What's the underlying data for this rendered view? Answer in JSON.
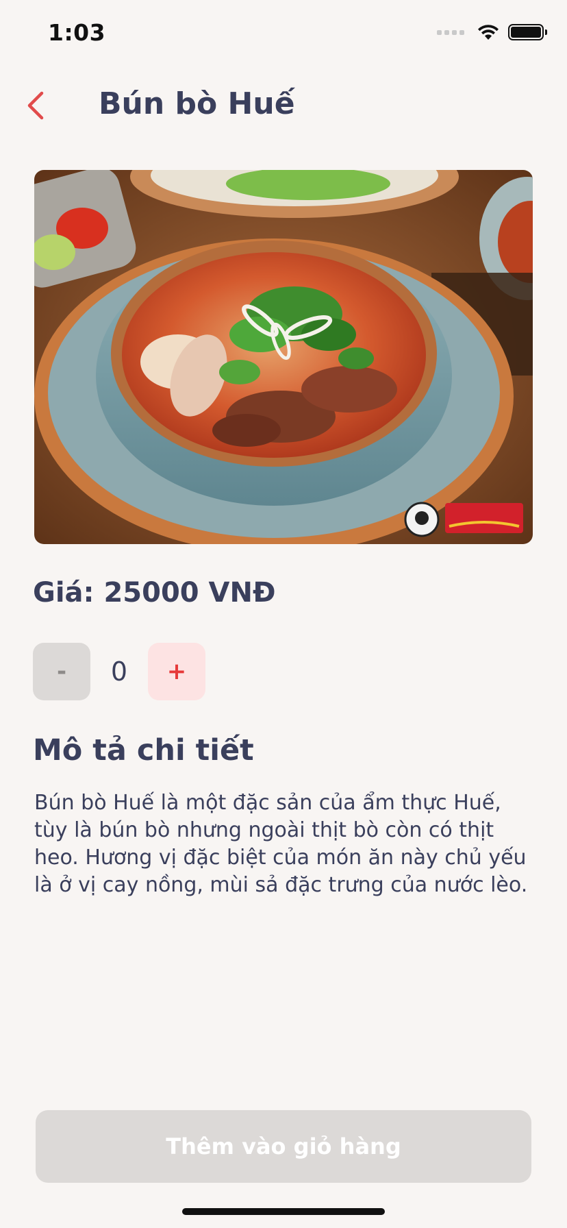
{
  "status_bar": {
    "time": "1:03",
    "icons": [
      "signal-icon",
      "wifi-icon",
      "battery-icon"
    ]
  },
  "header": {
    "back_icon": "chevron-left-icon",
    "title": "Bún bò Huế"
  },
  "image": {
    "subject": "bowl of Bún bò Huế",
    "logos": [
      "KỸ NĂNG",
      "Cholimex"
    ]
  },
  "price_text": "Giá: 25000 VNĐ",
  "quantity": {
    "minus_label": "-",
    "value": "0",
    "plus_label": "+"
  },
  "description": {
    "heading": "Mô tả chi tiết",
    "body": "Bún bò Huế là một đặc sản của ẩm thực Huế, tùy là bún bò nhưng ngoài thịt bò còn có thịt heo. Hương vị đặc biệt của món ăn này chủ yếu là ở vị cay nồng, mùi sả đặc trưng của nước lèo."
  },
  "add_to_cart_label": "Thêm vào giỏ hàng",
  "colors": {
    "background": "#f8f5f3",
    "text": "#3a3f5c",
    "accent": "#e63939",
    "disabled": "#dcd9d7"
  }
}
